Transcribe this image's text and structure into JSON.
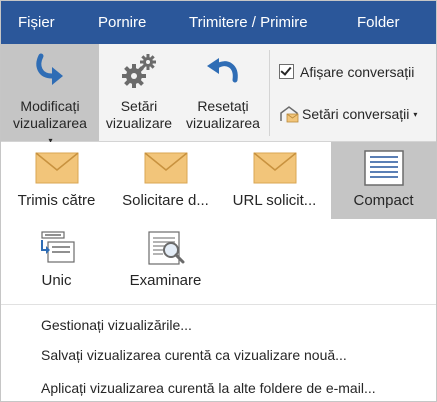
{
  "tabs": [
    "Fișier",
    "Pornire",
    "Trimitere / Primire",
    "Folder"
  ],
  "ribbon": {
    "change_view": {
      "line1": "Modificați",
      "line2": "vizualizarea",
      "caret": "▾",
      "icon": "change-view-arrow-icon"
    },
    "view_settings": {
      "line1": "Setări",
      "line2": "vizualizare",
      "icon": "gears-icon"
    },
    "reset_view": {
      "line1": "Resetați",
      "line2": "vizualizarea",
      "icon": "undo-arrow-icon"
    },
    "show_conversations": {
      "label": "Afișare conversații",
      "checked": true,
      "icon": "checkbox-icon"
    },
    "conversation_settings": {
      "label": "Setări conversații",
      "caret": "▾",
      "icon": "conversation-settings-icon"
    }
  },
  "gallery": {
    "items": [
      {
        "label": "Trimis către",
        "icon": "envelope-icon"
      },
      {
        "label": "Solicitare d...",
        "icon": "envelope-icon"
      },
      {
        "label": "URL solicit...",
        "icon": "envelope-icon"
      },
      {
        "label": "Compact",
        "icon": "compact-view-icon",
        "selected": true
      },
      {
        "label": "Unic",
        "icon": "single-view-icon"
      },
      {
        "label": "Examinare",
        "icon": "preview-magnifier-icon"
      }
    ]
  },
  "menu": {
    "items": [
      "Gestionați vizualizările...",
      "Salvați vizualizarea curentă ca vizualizare nouă...",
      "Aplicați vizualizarea curentă la alte foldere de e-mail..."
    ]
  },
  "colors": {
    "tab_bar": "#2b579a",
    "ribbon": "#f3f3f3",
    "selected": "#c5c5c5",
    "envelope": "#f2c57a",
    "accent_blue": "#2f6db5"
  }
}
